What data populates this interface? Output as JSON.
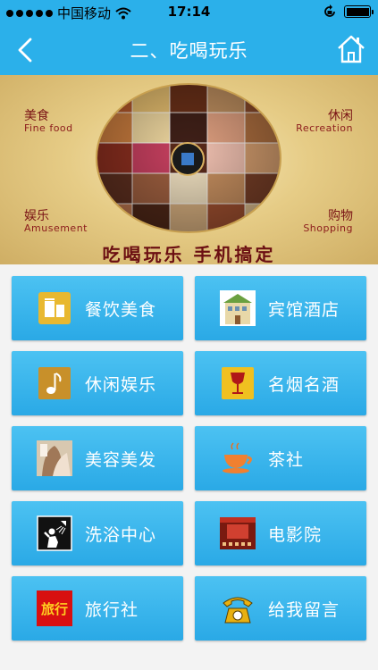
{
  "status_bar": {
    "carrier": "中国移动",
    "time": "17:14"
  },
  "nav": {
    "title": "二、吃喝玩乐"
  },
  "banner": {
    "top_left": {
      "cn": "美食",
      "en": "Fine food"
    },
    "top_right": {
      "cn": "休闲",
      "en": "Recreation"
    },
    "bottom_left": {
      "cn": "娱乐",
      "en": "Amusement"
    },
    "bottom_right": {
      "cn": "购物",
      "en": "Shopping"
    },
    "slogan": "吃喝玩乐  手机搞定"
  },
  "menu": {
    "items": [
      {
        "label": "餐饮美食",
        "icon": "drink-icon"
      },
      {
        "label": "宾馆酒店",
        "icon": "hotel-icon"
      },
      {
        "label": "休闲娱乐",
        "icon": "music-note-icon"
      },
      {
        "label": "名烟名酒",
        "icon": "wine-glass-icon"
      },
      {
        "label": "美容美发",
        "icon": "beauty-hair-icon"
      },
      {
        "label": "茶社",
        "icon": "teacup-icon"
      },
      {
        "label": "洗浴中心",
        "icon": "shower-icon"
      },
      {
        "label": "电影院",
        "icon": "cinema-icon"
      },
      {
        "label": "旅行社",
        "icon": "travel-agency-icon"
      },
      {
        "label": "给我留言",
        "icon": "telephone-icon"
      }
    ]
  },
  "colors": {
    "accent": "#2bb0ea",
    "tile": "#3ab6ee"
  }
}
